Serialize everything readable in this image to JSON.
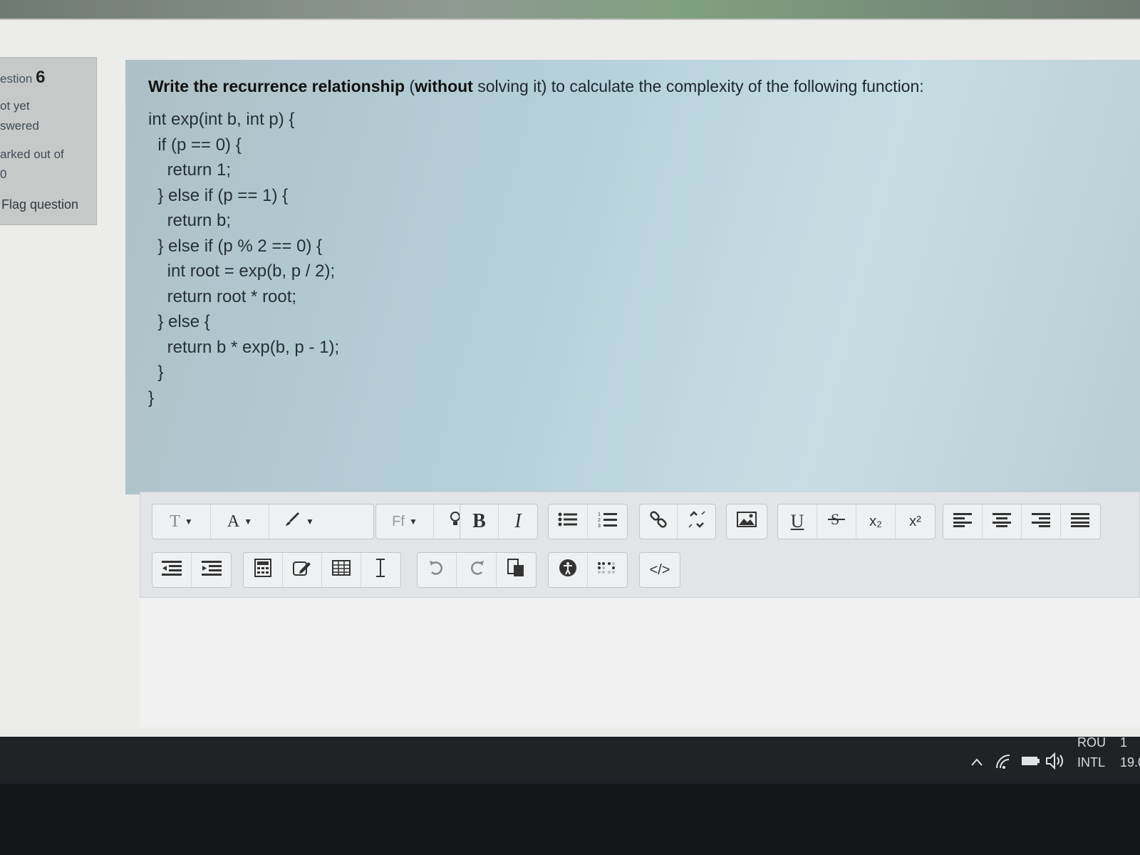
{
  "question_info": {
    "label": "estion",
    "number": "6",
    "status_line1": "ot yet",
    "status_line2": "swered",
    "marked_line1": "arked out of",
    "marked_line2": "0",
    "flag_label": "Flag question"
  },
  "question": {
    "prefix_bold": "Write the recurrence relationship",
    "open_paren": " (",
    "without_bold": "without",
    "rest": " solving it) to calculate the complexity of the following function:",
    "code_lines": [
      "int exp(int b, int p) {",
      "  if (p == 0) {",
      "    return 1;",
      "  } else if (p == 1) {",
      "    return b;",
      "  } else if (p % 2 == 0) {",
      "    int root = exp(b, p / 2);",
      "    return root * root;",
      "  } else {",
      "    return b * exp(b, p - 1);",
      "  }",
      "}"
    ]
  },
  "toolbar": {
    "row1": {
      "paragraph_style": "T",
      "font_size": "A",
      "font_family": "Ff",
      "bold": "B",
      "italic": "I",
      "underline": "U",
      "subscript": "x₂",
      "superscript": "x²"
    },
    "row2": {
      "html_source": "</>"
    }
  },
  "taskbar": {
    "lang_line1": "ROU",
    "lang_line2": "INTL",
    "time_partial": "1",
    "date_partial": "19.0"
  },
  "colors": {
    "question_panel": "#b5d0da",
    "info_panel": "#c6c9c7",
    "taskbar": "#1f2326"
  }
}
